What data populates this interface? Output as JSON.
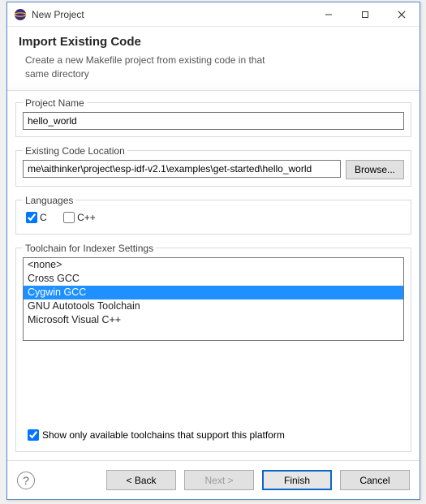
{
  "window": {
    "title": "New Project"
  },
  "header": {
    "title": "Import Existing Code",
    "subtitle_l1": "Create a new Makefile project from existing code in that",
    "subtitle_l2": "same directory"
  },
  "project_name": {
    "legend": "Project Name",
    "value": "hello_world"
  },
  "code_location": {
    "legend": "Existing Code Location",
    "value": "me\\aithinker\\project\\esp-idf-v2.1\\examples\\get-started\\hello_world",
    "browse_label": "Browse..."
  },
  "languages": {
    "legend": "Languages",
    "c_label": "C",
    "c_checked": true,
    "cpp_label": "C++",
    "cpp_checked": false
  },
  "toolchain": {
    "legend": "Toolchain for Indexer Settings",
    "items": [
      {
        "label": "<none>",
        "selected": false
      },
      {
        "label": "Cross GCC",
        "selected": false
      },
      {
        "label": "Cygwin GCC",
        "selected": true
      },
      {
        "label": "GNU Autotools Toolchain",
        "selected": false
      },
      {
        "label": "Microsoft Visual C++",
        "selected": false
      }
    ],
    "show_only_checked": true,
    "show_only_label": "Show only available toolchains that support this platform"
  },
  "footer": {
    "back": "< Back",
    "next": "Next >",
    "finish": "Finish",
    "cancel": "Cancel"
  }
}
